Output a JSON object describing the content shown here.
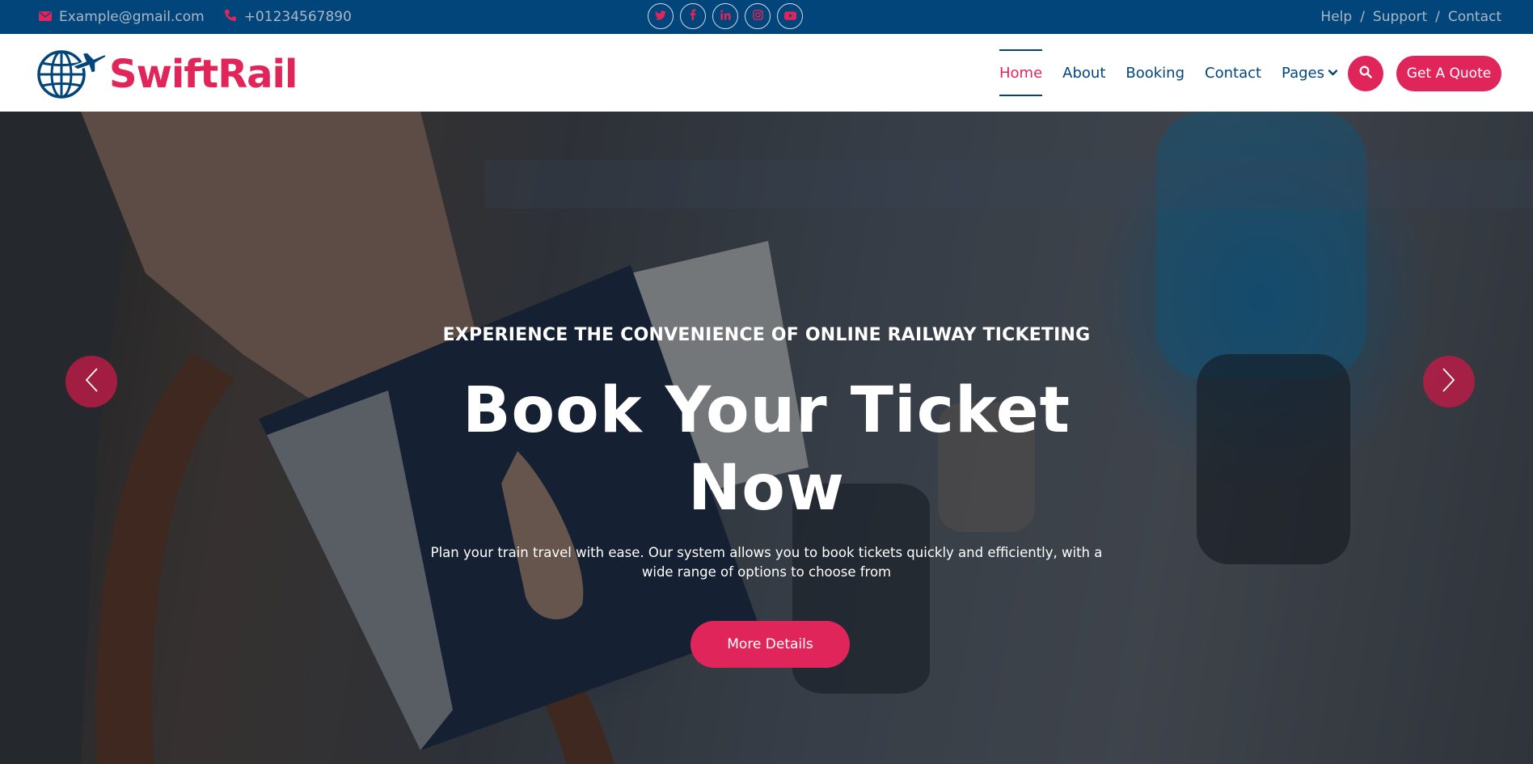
{
  "topbar": {
    "email": "Example@gmail.com",
    "phone": "+01234567890",
    "social": [
      "twitter-icon",
      "facebook-icon",
      "linkedin-icon",
      "instagram-icon",
      "youtube-icon"
    ],
    "links": [
      "Help",
      "Support",
      "Contact"
    ],
    "separator": "/"
  },
  "brand": {
    "name": "SwiftRail",
    "logo": "globe-airplane-icon"
  },
  "nav": {
    "items": [
      {
        "label": "Home",
        "active": true
      },
      {
        "label": "About",
        "active": false
      },
      {
        "label": "Booking",
        "active": false
      },
      {
        "label": "Contact",
        "active": false
      },
      {
        "label": "Pages",
        "active": false,
        "dropdown": true
      }
    ],
    "search_icon": "search-icon",
    "quote_label": "Get A Quote"
  },
  "hero": {
    "kicker": "EXPERIENCE THE CONVENIENCE OF ONLINE RAILWAY TICKETING",
    "title_line1": "Book Your Ticket",
    "title_line2": "Now",
    "description": "Plan your train travel with ease. Our system allows you to book tickets quickly and efficiently, with a wide range of options to choose from",
    "cta_label": "More Details"
  },
  "colors": {
    "brand": "#e0255a",
    "navy": "#02457a",
    "white": "#ffffff"
  }
}
